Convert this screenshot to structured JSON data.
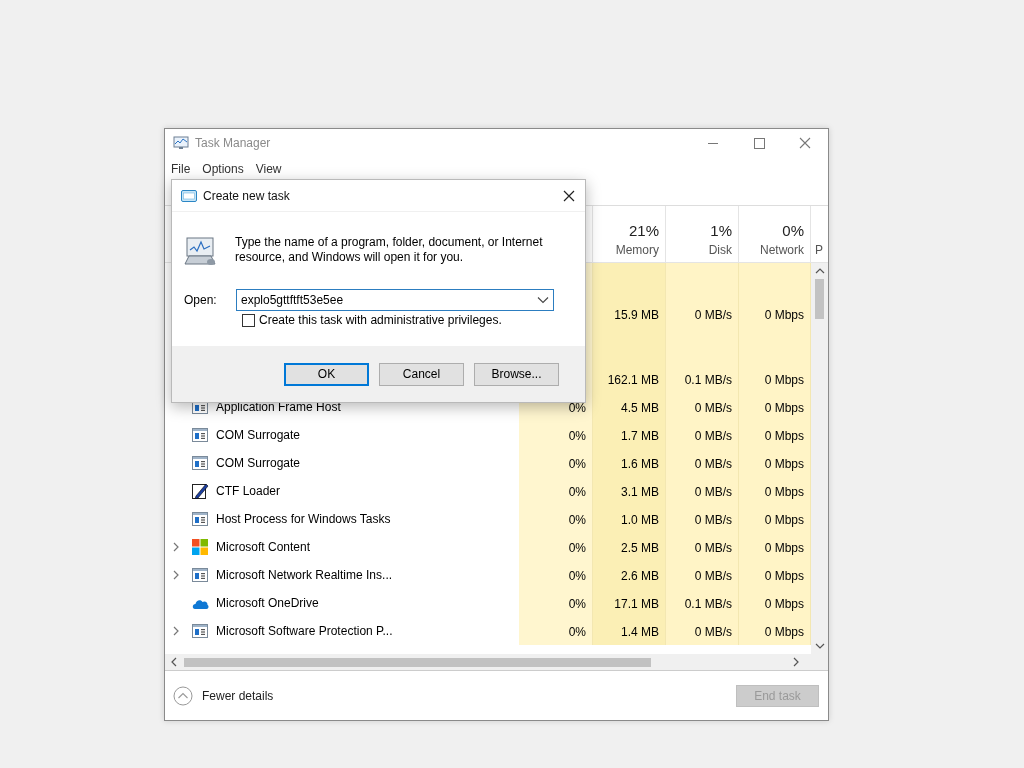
{
  "window": {
    "title": "Task Manager"
  },
  "menu": [
    "File",
    "Options",
    "View"
  ],
  "columns": [
    {
      "percent": "21%",
      "label": "Memory"
    },
    {
      "percent": "1%",
      "label": "Disk"
    },
    {
      "percent": "0%",
      "label": "Network"
    },
    {
      "label": "P"
    }
  ],
  "rows": [
    {
      "kind": "section"
    },
    {
      "kind": "process",
      "memory": "15.9 MB",
      "disk": "0 MB/s",
      "network": "0 Mbps"
    },
    {
      "kind": "section"
    },
    {
      "kind": "process",
      "memory": "162.1 MB",
      "disk": "0.1 MB/s",
      "network": "0 Mbps"
    },
    {
      "kind": "window",
      "name": "Application Frame Host",
      "expandable": false,
      "cpu": "0%",
      "memory": "4.5 MB",
      "disk": "0 MB/s",
      "network": "0 Mbps"
    },
    {
      "kind": "window",
      "name": "COM Surrogate",
      "expandable": false,
      "cpu": "0%",
      "memory": "1.7 MB",
      "disk": "0 MB/s",
      "network": "0 Mbps"
    },
    {
      "kind": "window",
      "name": "COM Surrogate",
      "expandable": false,
      "cpu": "0%",
      "memory": "1.6 MB",
      "disk": "0 MB/s",
      "network": "0 Mbps"
    },
    {
      "kind": "pen",
      "name": "CTF Loader",
      "expandable": false,
      "cpu": "0%",
      "memory": "3.1 MB",
      "disk": "0 MB/s",
      "network": "0 Mbps"
    },
    {
      "kind": "window",
      "name": "Host Process for Windows Tasks",
      "expandable": false,
      "cpu": "0%",
      "memory": "1.0 MB",
      "disk": "0 MB/s",
      "network": "0 Mbps"
    },
    {
      "kind": "tiles",
      "name": "Microsoft Content",
      "expandable": true,
      "cpu": "0%",
      "memory": "2.5 MB",
      "disk": "0 MB/s",
      "network": "0 Mbps"
    },
    {
      "kind": "window",
      "name": "Microsoft Network Realtime Ins...",
      "expandable": true,
      "cpu": "0%",
      "memory": "2.6 MB",
      "disk": "0 MB/s",
      "network": "0 Mbps"
    },
    {
      "kind": "cloud",
      "name": "Microsoft OneDrive",
      "expandable": false,
      "cpu": "0%",
      "memory": "17.1 MB",
      "disk": "0.1 MB/s",
      "network": "0 Mbps"
    },
    {
      "kind": "window",
      "name": "Microsoft Software Protection P...",
      "expandable": true,
      "cpu": "0%",
      "memory": "1.4 MB",
      "disk": "0 MB/s",
      "network": "0 Mbps"
    }
  ],
  "footer": {
    "fewer_details": "Fewer details",
    "end_task": {
      "label": "End task",
      "disabled": true
    }
  },
  "dialog": {
    "title": "Create new task",
    "message": "Type the name of a program, folder, document, or Internet resource, and Windows will open it for you.",
    "open_label": "Open:",
    "open_value": "explo5gttftft53e5ee",
    "admin_checkbox": {
      "label": "Create this task with administrative privileges.",
      "checked": false
    },
    "buttons": [
      {
        "label": "OK",
        "default": true
      },
      {
        "label": "Cancel",
        "default": false
      },
      {
        "label": "Browse...",
        "default": false
      }
    ]
  }
}
